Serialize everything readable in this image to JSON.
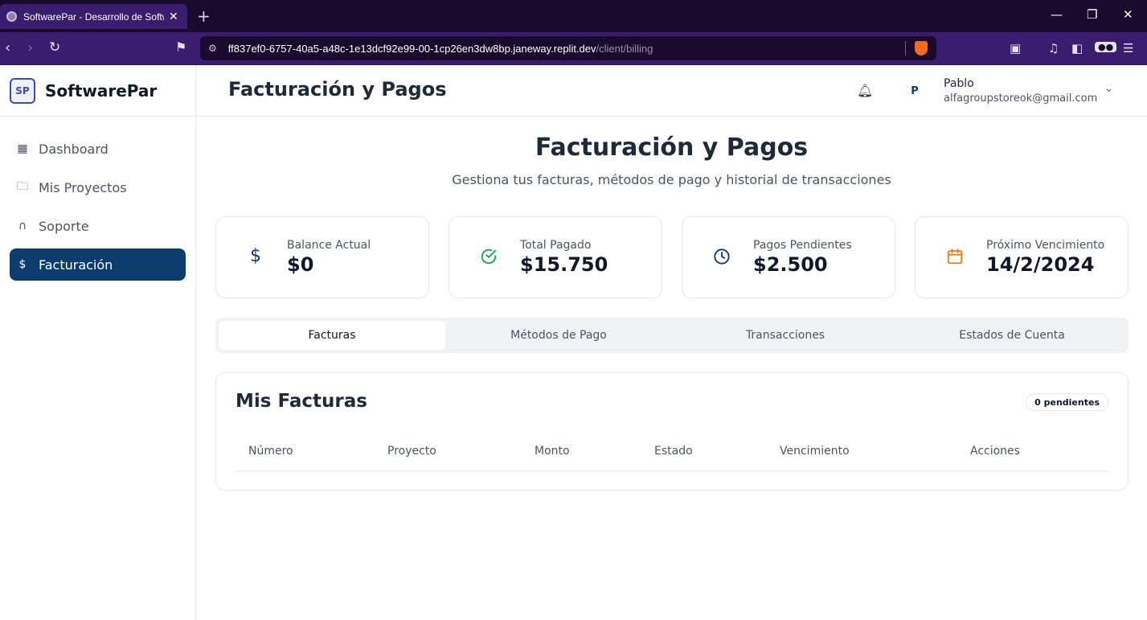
{
  "browser": {
    "tab_title": "SoftwarePar - Desarrollo de Software",
    "url_host": "ff837ef0-6757-40a5-a48c-1e13dcf92e99-00-1cp26en3dw8bp.janeway.replit.dev",
    "url_path": "/client/billing"
  },
  "sidebar": {
    "brand_name": "SoftwarePar",
    "brand_logo_text": "SP",
    "items": [
      {
        "label": "Dashboard",
        "icon": "grid-icon"
      },
      {
        "label": "Mis Proyectos",
        "icon": "folder-icon"
      },
      {
        "label": "Soporte",
        "icon": "headphones-icon"
      },
      {
        "label": "Facturación",
        "icon": "invoice-icon",
        "active": true
      }
    ]
  },
  "header": {
    "title": "Facturación y Pagos",
    "avatar_initial": "P",
    "user_name": "Pablo",
    "user_email": "alfagroupstoreok@gmail.com"
  },
  "main": {
    "title": "Facturación y Pagos",
    "subtitle": "Gestiona tus facturas, métodos de pago y historial de transacciones",
    "stats": [
      {
        "label": "Balance Actual",
        "value": "$0",
        "icon": "dollar-icon",
        "color": "#0c3c6e"
      },
      {
        "label": "Total Pagado",
        "value": "$15.750",
        "icon": "check-circle-icon",
        "color": "#16a34a"
      },
      {
        "label": "Pagos Pendientes",
        "value": "$2.500",
        "icon": "clock-icon",
        "color": "#0c3c6e"
      },
      {
        "label": "Próximo Vencimiento",
        "value": "14/2/2024",
        "icon": "calendar-icon",
        "color": "#ea7c1c"
      }
    ],
    "tabs": [
      {
        "label": "Facturas",
        "active": true
      },
      {
        "label": "Métodos de Pago"
      },
      {
        "label": "Transacciones"
      },
      {
        "label": "Estados de Cuenta"
      }
    ],
    "invoices": {
      "title": "Mis Facturas",
      "badge": "0 pendientes",
      "columns": [
        "Número",
        "Proyecto",
        "Monto",
        "Estado",
        "Vencimiento",
        "Acciones"
      ]
    }
  }
}
